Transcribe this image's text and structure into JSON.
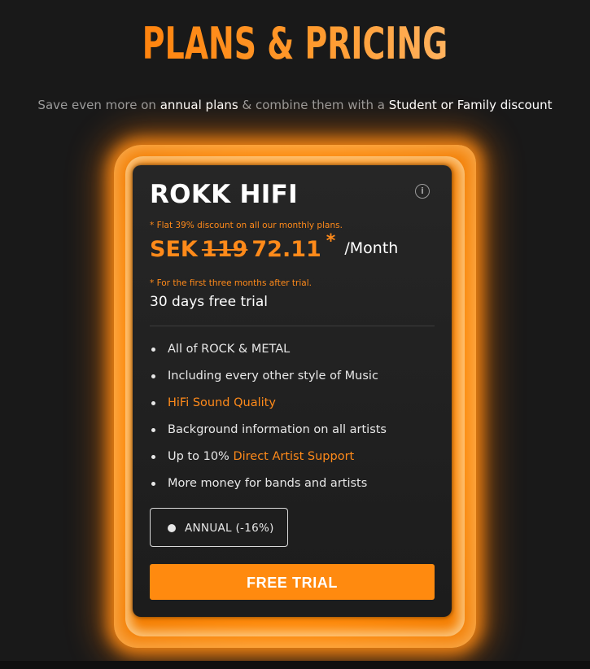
{
  "page": {
    "title": "PLANS & PRICING",
    "subtitle": {
      "part1": "Save even more on ",
      "highlight1": "annual plans",
      "part2": " & combine them with a ",
      "highlight2": "Student or Family discount"
    }
  },
  "plan": {
    "name": "ROKK HIFI",
    "info_icon": "info-circle-icon",
    "discount_note": "* Flat 39% discount on all our monthly plans.",
    "price": {
      "currency": "SEK",
      "old": "119",
      "new": "72.11",
      "star": "*",
      "period": "/Month"
    },
    "trial_note": "* For the first three months after trial.",
    "trial_text": "30 days free trial",
    "features": [
      {
        "text": "All of ROCK & METAL"
      },
      {
        "text": "Including every other style of Music"
      },
      {
        "accent": "HiFi Sound Quality"
      },
      {
        "text": "Background information on all artists"
      },
      {
        "text": "Up to 10% ",
        "accent": "Direct Artist Support"
      },
      {
        "text": "More money for bands and artists"
      }
    ],
    "billing_toggle": "ANNUAL (-16%)",
    "cta": "FREE TRIAL"
  },
  "colors": {
    "accent": "#ff8a1a",
    "background": "#191919",
    "card": "#222222"
  }
}
